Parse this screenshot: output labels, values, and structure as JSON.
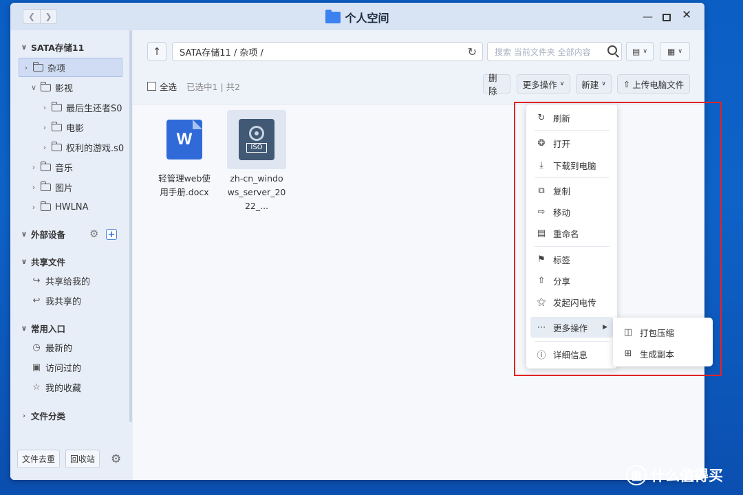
{
  "window": {
    "title": "个人空间"
  },
  "sidebar": {
    "storage": "SATA存储11",
    "tree": [
      {
        "label": "杂项",
        "selected": true
      },
      {
        "label": "影视"
      },
      {
        "label": "最后生还者S0"
      },
      {
        "label": "电影"
      },
      {
        "label": "权利的游戏.s0"
      },
      {
        "label": "音乐"
      },
      {
        "label": "图片"
      },
      {
        "label": "HWLNA"
      }
    ],
    "external": "外部设备",
    "shared": {
      "title": "共享文件",
      "items": [
        "共享给我的",
        "我共享的"
      ]
    },
    "common": {
      "title": "常用入口",
      "items": [
        "最新的",
        "访问过的",
        "我的收藏"
      ]
    },
    "category": "文件分类",
    "bottom": {
      "dedupe": "文件去重",
      "recycle": "回收站"
    }
  },
  "toolbar": {
    "path": "SATA存储11 / 杂项 /",
    "search_placeholder": "搜索 当前文件夹 全部内容",
    "select_all": "全选",
    "selection_status": "已选中1 | 共2",
    "delete": "删除",
    "more_ops": "更多操作",
    "new": "新建",
    "upload": "上传电脑文件"
  },
  "files": [
    {
      "name": "轻管理web使用手册.docx",
      "type": "word",
      "badge": "W",
      "selected": false
    },
    {
      "name": "zh-cn_windows_server_2022_...",
      "type": "iso",
      "badge": "ISO",
      "selected": true
    }
  ],
  "context_menu": {
    "items": [
      "刷新",
      "打开",
      "下载到电脑",
      "复制",
      "移动",
      "重命名",
      "标签",
      "分享",
      "发起闪电传",
      "更多操作",
      "详细信息"
    ],
    "submenu": [
      "打包压缩",
      "生成副本"
    ]
  },
  "watermark": "什么值得买",
  "watermark_glyph": "值"
}
